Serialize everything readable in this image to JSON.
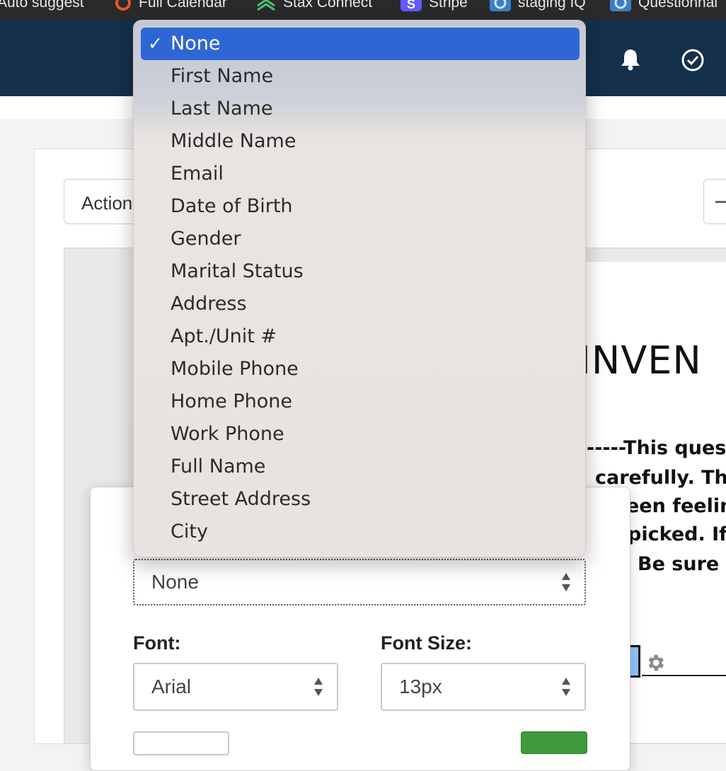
{
  "bookmarks": [
    {
      "label": "Auto suggest",
      "icon": "none"
    },
    {
      "label": "Full Calendar",
      "icon": "q-orange-icon"
    },
    {
      "label": "Stax Connect",
      "icon": "stax-chevrons-icon"
    },
    {
      "label": "Stripe",
      "icon": "stripe-s-icon"
    },
    {
      "label": "staging IQ",
      "icon": "iq-icon"
    },
    {
      "label": "Questionnai",
      "icon": "iq-icon"
    }
  ],
  "header": {
    "icons": [
      "bell-icon",
      "check-circle-icon"
    ],
    "bg_color": "#14304a"
  },
  "toolbar": {
    "actions_label": "Actions"
  },
  "document": {
    "title_fragment": "INVEN",
    "lines": [
      "-----This ques",
      "carefully. Th",
      "een feelin",
      "picked. If",
      "Be sure"
    ]
  },
  "field_settings": {
    "mapping_value": "None",
    "font_label": "Font:",
    "font_value": "Arial",
    "font_size_label": "Font Size:",
    "font_size_value": "13px"
  },
  "dropdown": {
    "selected_index": 0,
    "check_glyph": "✓",
    "options": [
      "None",
      "First Name",
      "Last Name",
      "Middle Name",
      "Email",
      "Date of Birth",
      "Gender",
      "Marital Status",
      "Address",
      "Apt./Unit #",
      "Mobile Phone",
      "Home Phone",
      "Work Phone",
      "Full Name",
      "Street Address",
      "City"
    ]
  },
  "colors": {
    "selection_blue": "#2f66d6",
    "primary_green": "#3f9a3c"
  }
}
